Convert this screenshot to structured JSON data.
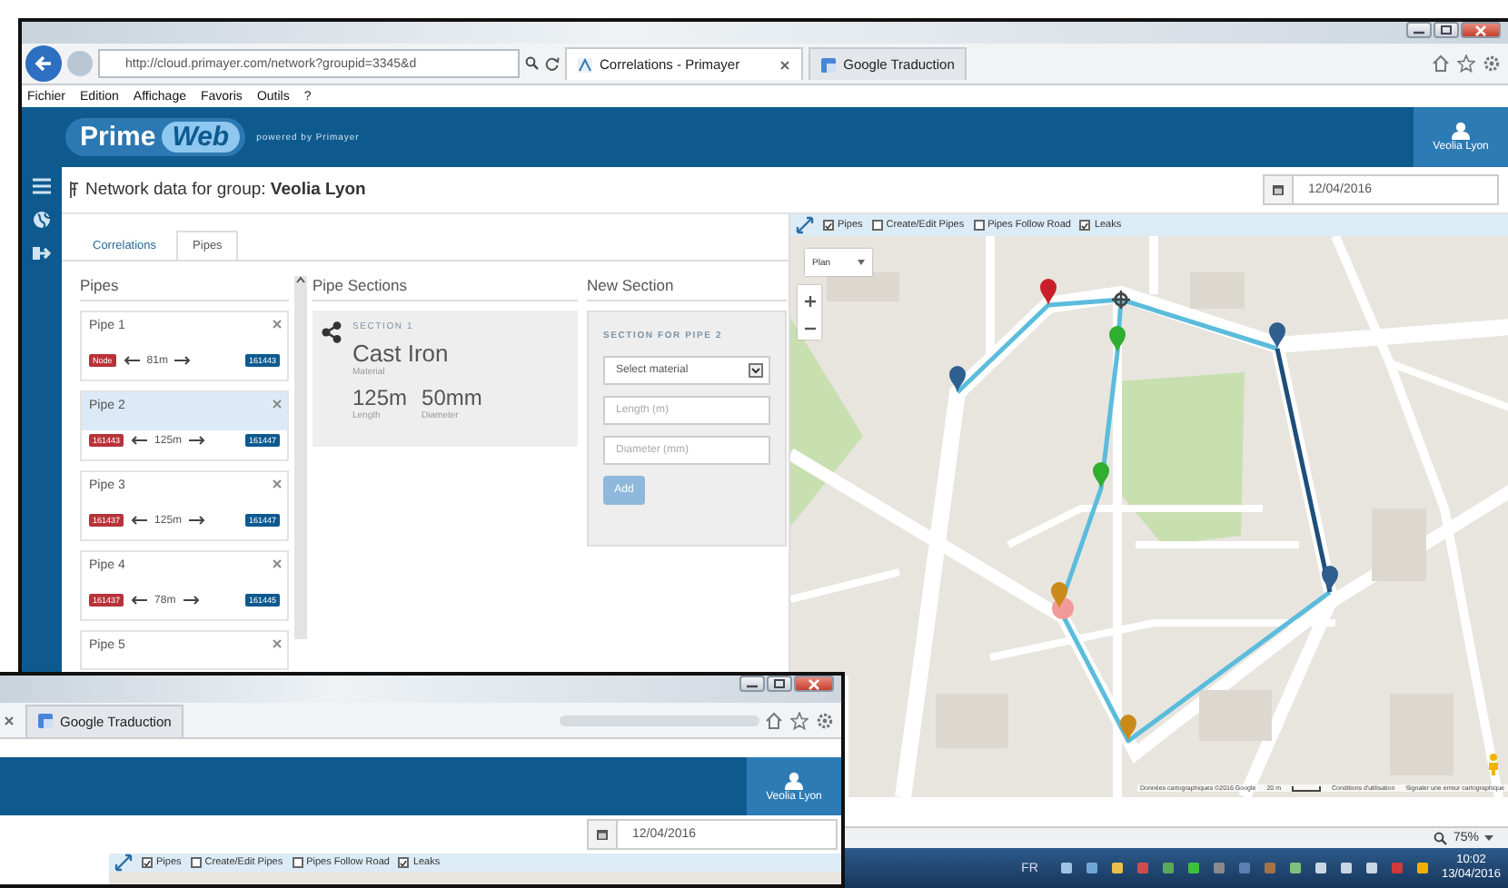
{
  "browser": {
    "address": "http://cloud.primayer.com/network?groupid=3345&d",
    "tabs": [
      {
        "label": "Correlations - Primayer",
        "selected": true
      },
      {
        "label": "Google Traduction",
        "selected": false
      }
    ],
    "menu": [
      "Fichier",
      "Edition",
      "Affichage",
      "Favoris",
      "Outils",
      "?"
    ],
    "zoom": "75%"
  },
  "app": {
    "logo_left": "Prime",
    "logo_right": "Web",
    "tagline": "powered by Primayer",
    "user": "Veolia Lyon",
    "title": "Network data for group: **Veolia Lyon**",
    "date": "12/04/2016"
  },
  "tabs": [
    {
      "label": "Correlations",
      "selected": false
    },
    {
      "label": "Pipes",
      "selected": true
    }
  ],
  "pipes": {
    "heading": "Pipes",
    "items": [
      {
        "name": "Pipe 1",
        "selected": false,
        "from": "Node",
        "length": "81m",
        "to": "161443"
      },
      {
        "name": "Pipe 2",
        "selected": true,
        "from": "161443",
        "length": "125m",
        "to": "161447"
      },
      {
        "name": "Pipe 3",
        "selected": false,
        "from": "161437",
        "length": "125m",
        "to": "161447"
      },
      {
        "name": "Pipe 4",
        "selected": false,
        "from": "161437",
        "length": "78m",
        "to": "161445"
      },
      {
        "name": "Pipe 5",
        "selected": false
      }
    ]
  },
  "sections": {
    "heading": "Pipe Sections",
    "items": [
      {
        "label": "SECTION 1",
        "material": "Cast Iron",
        "material_label": "Material",
        "length": "125m",
        "length_label": "Length",
        "diameter": "50mm",
        "diameter_label": "Diameter"
      }
    ]
  },
  "new_section": {
    "heading": "New Section",
    "title": "SECTION FOR PIPE 2",
    "material_select": "Select material",
    "length_placeholder": "Length (m)",
    "diameter_placeholder": "Diameter (mm)",
    "button": {
      "label": "Add",
      "disabled": true
    }
  },
  "map": {
    "layers": [
      {
        "label": "Pipes",
        "checked": true
      },
      {
        "label": "Create/Edit Pipes",
        "checked": false
      },
      {
        "label": "Pipes Follow Road",
        "checked": false
      },
      {
        "label": "Leaks",
        "checked": true
      }
    ],
    "map_type": "Plan",
    "attribution": [
      "Données cartographiques ©2016 Google",
      "20 m",
      "Conditions d'utilisation",
      "Signaler une erreur cartographique"
    ],
    "markers": [
      {
        "kind": "pin",
        "color": "#2f5f8f"
      },
      {
        "kind": "pin",
        "color": "#c8202a"
      },
      {
        "kind": "junction",
        "color": "#444444"
      },
      {
        "kind": "pin",
        "color": "#2fae2f"
      },
      {
        "kind": "pin",
        "color": "#2fae2f"
      },
      {
        "kind": "pin",
        "color": "#2f5f8f"
      },
      {
        "kind": "pin",
        "color": "#2f5f8f"
      },
      {
        "kind": "leak",
        "color": "#f29a9a"
      },
      {
        "kind": "pin",
        "color": "#c98a1a"
      },
      {
        "kind": "pin",
        "color": "#c98a1a"
      }
    ]
  },
  "taskbar": {
    "language": "FR",
    "time": "10:02",
    "date": "13/04/2016"
  },
  "second_window": {
    "tabs": [
      {
        "label": "Google Traduction",
        "selected": false
      }
    ],
    "user": "Veolia Lyon",
    "date": "12/04/2016",
    "layers": [
      {
        "label": "Pipes",
        "checked": true
      },
      {
        "label": "Create/Edit Pipes",
        "checked": false
      },
      {
        "label": "Pipes Follow Road",
        "checked": false
      },
      {
        "label": "Leaks",
        "checked": true
      }
    ]
  }
}
